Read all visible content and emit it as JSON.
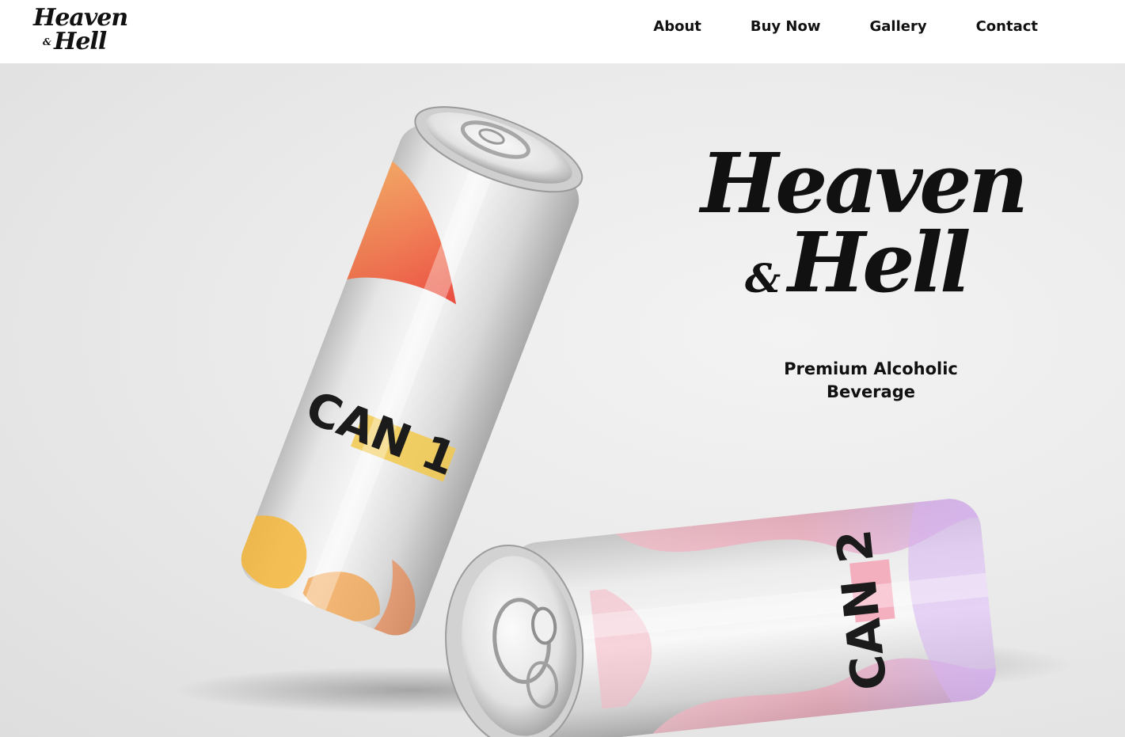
{
  "header": {
    "logo_line1": "Heaven",
    "logo_amp": "&",
    "logo_line2": "Hell",
    "nav": [
      {
        "label": "About"
      },
      {
        "label": "Buy Now"
      },
      {
        "label": "Gallery"
      },
      {
        "label": "Contact"
      }
    ]
  },
  "hero": {
    "logo_line1": "Heaven",
    "logo_amp": "&",
    "logo_line2": "Hell",
    "tagline_line1": "Premium Alcoholic",
    "tagline_line2": "Beverage",
    "can1_label": "CAN 1",
    "can2_label": "CAN 2",
    "colors": {
      "can1_label_highlight": "#f2c94c",
      "can1_accent": "#f04b2a",
      "can1_swirl": "#f5b83a",
      "can2_accent_pink": "#f4a3b6",
      "can2_accent_violet": "#c9a6ef"
    }
  }
}
